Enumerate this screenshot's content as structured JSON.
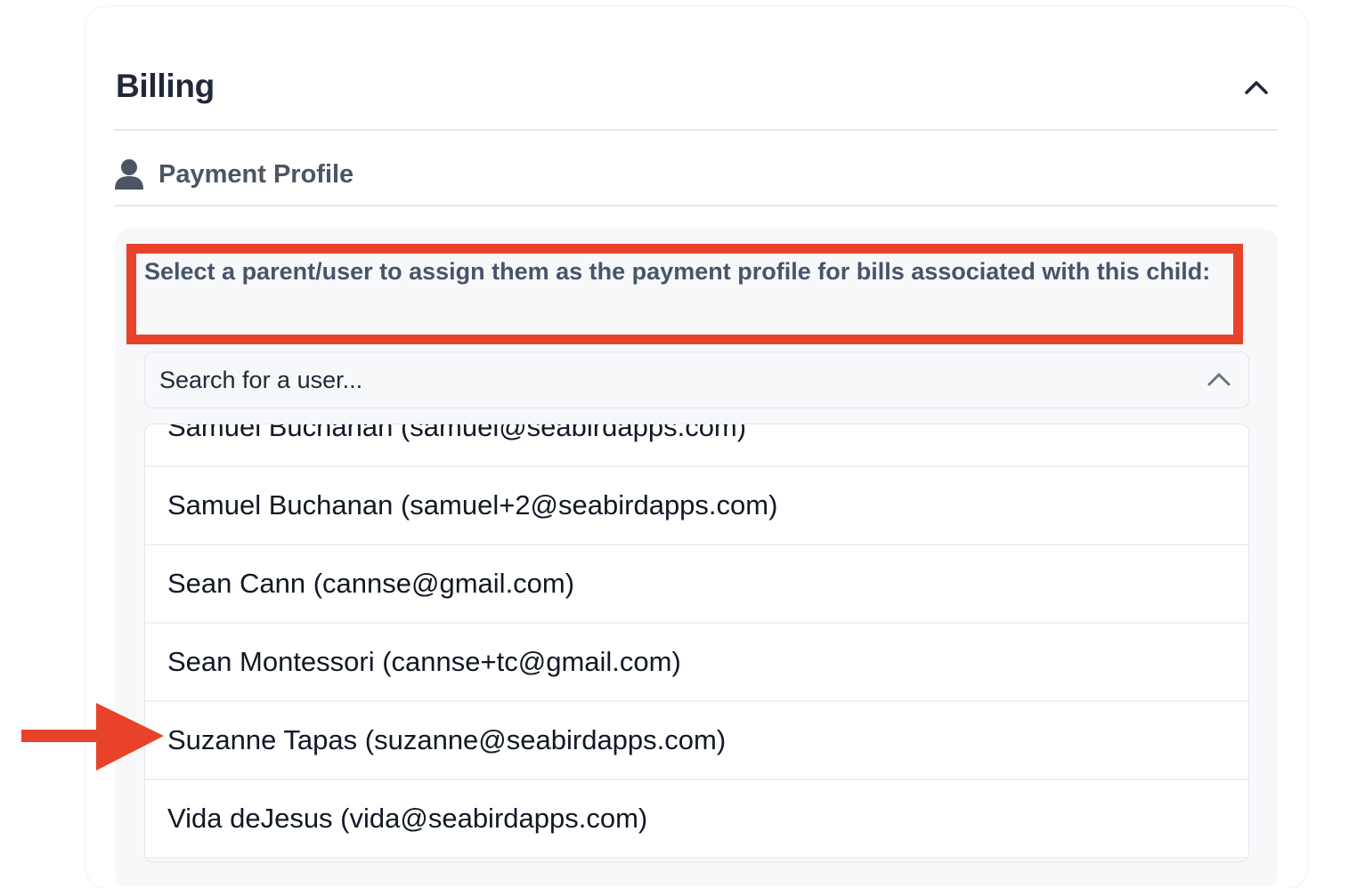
{
  "billing": {
    "title": "Billing"
  },
  "payment_profile": {
    "title": "Payment Profile",
    "instruction": "Select a parent/user to assign them as the payment profile for bills associated with this child:"
  },
  "user_select": {
    "placeholder": "Search for a user...",
    "options": [
      "Samuel Buchanan (samuel@seabirdapps.com)",
      "Samuel Buchanan (samuel+2@seabirdapps.com)",
      "Sean Cann (cannse@gmail.com)",
      "Sean Montessori (cannse+tc@gmail.com)",
      "Suzanne Tapas (suzanne@seabirdapps.com)",
      "Vida deJesus (vida@seabirdapps.com)"
    ]
  },
  "icons": {
    "collapse": "chevron-up-icon",
    "profile": "user-icon",
    "select_toggle": "chevron-up-icon",
    "pointer": "red-arrow"
  },
  "colors": {
    "highlight": "#e8432a",
    "arrow": "#e8432a",
    "heading": "#1f2937",
    "subheading": "#4b5563",
    "instruction": "#475569"
  }
}
